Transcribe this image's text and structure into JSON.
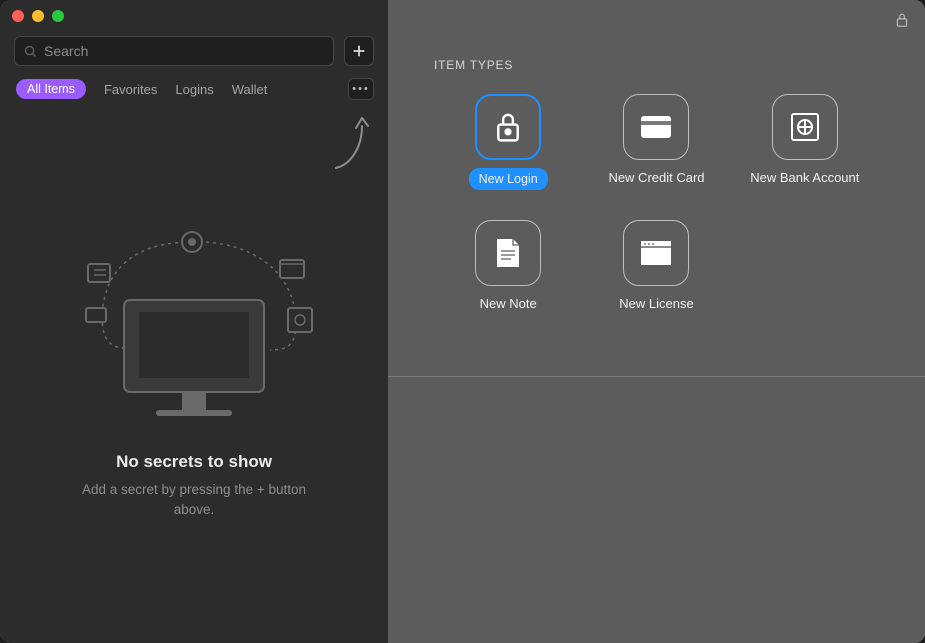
{
  "search": {
    "placeholder": "Search"
  },
  "tabs": {
    "all_items": "All Items",
    "favorites": "Favorites",
    "logins": "Logins",
    "wallet": "Wallet"
  },
  "empty": {
    "title": "No secrets to show",
    "subtitle": "Add a secret by pressing the + button above."
  },
  "item_types": {
    "heading": "ITEM TYPES",
    "tiles": {
      "login": "New Login",
      "credit_card": "New Credit Card",
      "bank_account": "New Bank Account",
      "note": "New Note",
      "license": "New License"
    }
  }
}
